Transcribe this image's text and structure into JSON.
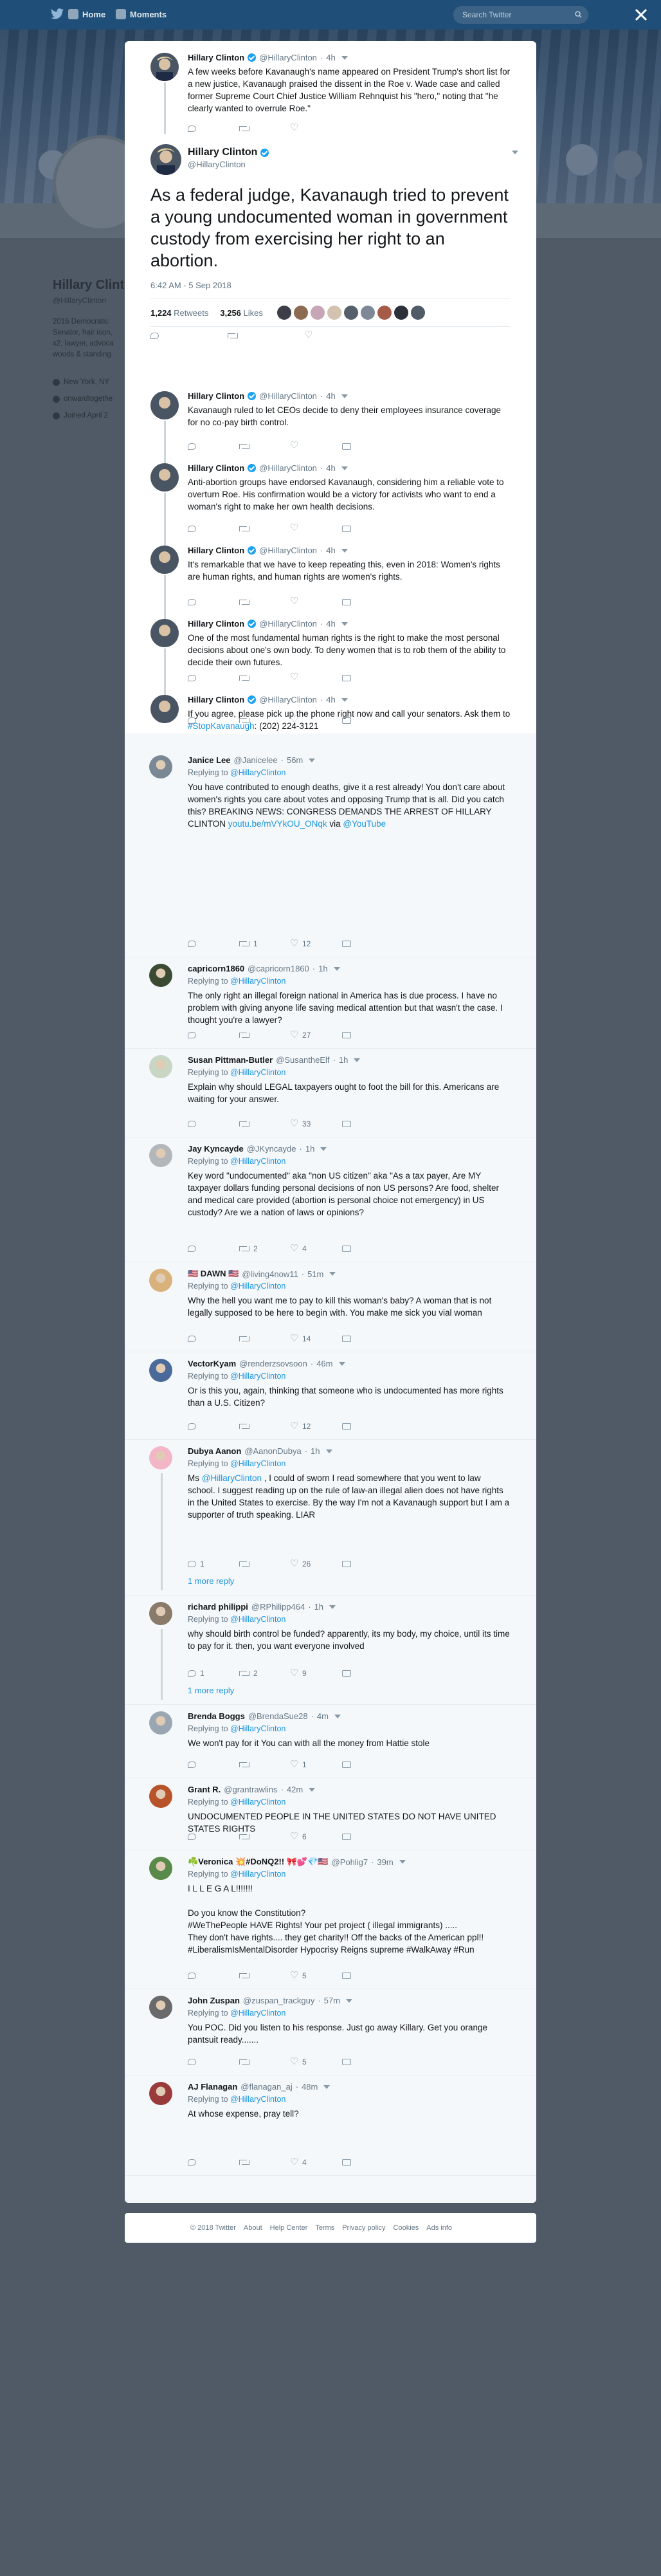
{
  "topnav": {
    "home": "Home",
    "moments": "Moments",
    "search_placeholder": "Search Twitter"
  },
  "profile": {
    "name": "Hillary Clinton",
    "handle": "@HillaryClinton",
    "bio_lines": [
      "2016 Democratic",
      "Senator, hair icon,",
      "x2, lawyer, advoca",
      "woods & standing"
    ],
    "location": "New York, NY",
    "website": "onwardtogethe",
    "joined": "Joined April 2"
  },
  "thread": [
    {
      "name": "Hillary Clinton",
      "handle": "@HillaryClinton",
      "time": "4h",
      "text": "A few weeks before Kavanaugh's name appeared on President Trump's short list for a new justice, Kavanaugh praised the dissent in the Roe v. Wade case and called former Supreme Court Chief Justice William Rehnquist his \"hero,\" noting that \"he clearly wanted to overrule Roe.\""
    }
  ],
  "main_tweet": {
    "name": "Hillary Clinton",
    "handle": "@HillaryClinton",
    "text": "As a federal judge, Kavanaugh tried to prevent a young undocumented woman in government custody from exercising her right to an abortion.",
    "timestamp": "6:42 AM - 5 Sep 2018",
    "retweets": "1,224",
    "retweets_label": "Retweets",
    "likes": "3,256",
    "likes_label": "Likes"
  },
  "followups": [
    {
      "name": "Hillary Clinton",
      "handle": "@HillaryClinton",
      "time": "4h",
      "text": "Kavanaugh ruled to let CEOs decide to deny their employees insurance coverage for no co-pay birth control."
    },
    {
      "name": "Hillary Clinton",
      "handle": "@HillaryClinton",
      "time": "4h",
      "text": "Anti-abortion groups have endorsed Kavanaugh, considering him a reliable vote to overturn Roe. His confirmation would be a victory for activists who want to end a woman's right to make her own health decisions."
    },
    {
      "name": "Hillary Clinton",
      "handle": "@HillaryClinton",
      "time": "4h",
      "text": "It's remarkable that we have to keep repeating this, even in 2018: Women's rights are human rights, and human rights are women's rights."
    },
    {
      "name": "Hillary Clinton",
      "handle": "@HillaryClinton",
      "time": "4h",
      "text": "One of the most fundamental human rights is the right to make the most personal decisions about one's own body. To deny women that is to rob them of the ability to decide their own futures."
    },
    {
      "name": "Hillary Clinton",
      "handle": "@HillaryClinton",
      "time": "4h",
      "text_pre": "If you agree, please pick up the phone right now and call your senators. Ask them to ",
      "hashtag": "#StopKavanaugh",
      "text_post": ": (202) 224-3121"
    }
  ],
  "replies": [
    {
      "name": "Janice Lee",
      "handle": "@Janicelee",
      "time": "56m",
      "replying": "Replying to",
      "mention": "@HillaryClinton",
      "text": "You have contributed to enough deaths, give it a rest already! You don't care about women's rights you care about votes and opposing Trump that is all. Did you catch this? BREAKING NEWS: CONGRESS DEMANDS THE ARREST OF HILLARY CLINTON ",
      "link": "youtu.be/mVYkOU_ONqk",
      "via": " via ",
      "via_link": "@YouTube",
      "reply_count": "",
      "rt_count": "1",
      "like_count": "12"
    },
    {
      "name": "capricorn1860",
      "handle": "@capricorn1860",
      "time": "1h",
      "replying": "Replying to",
      "mention": "@HillaryClinton",
      "text": "The only right an illegal foreign national in America has is due process. I have no problem with giving anyone life saving medical attention but that wasn't the case. I thought you're a lawyer?",
      "reply_count": "",
      "rt_count": "",
      "like_count": "27"
    },
    {
      "name": "Susan Pittman-Butler",
      "handle": "@SusantheElf",
      "time": "1h",
      "replying": "Replying to",
      "mention": "@HillaryClinton",
      "text": "Explain why should LEGAL taxpayers ought to foot the bill for this. Americans are waiting for your answer.",
      "reply_count": "",
      "rt_count": "",
      "like_count": "33"
    },
    {
      "name": "Jay Kyncayde",
      "handle": "@JKyncayde",
      "time": "1h",
      "replying": "Replying to",
      "mention": "@HillaryClinton",
      "text": "Key word \"undocumented\" aka \"non US citizen\" aka \"As a tax payer, Are MY taxpayer dollars funding personal decisions of non US persons? Are food, shelter and medical care provided (abortion is personal choice not emergency) in US custody? Are we a nation of laws or opinions?",
      "reply_count": "",
      "rt_count": "2",
      "like_count": "4"
    },
    {
      "name": "🇺🇸 DAWN 🇺🇸",
      "handle": "@living4now11",
      "time": "51m",
      "replying": "Replying to",
      "mention": "@HillaryClinton",
      "text": "Why the hell you want me to pay to kill this woman's baby? A woman that is not legally supposed to be here to begin with. You make me sick you vial woman",
      "reply_count": "",
      "rt_count": "",
      "like_count": "14"
    },
    {
      "name": "VectorKyam",
      "handle": "@renderzsovsoon",
      "time": "46m",
      "replying": "Replying to",
      "mention": "@HillaryClinton",
      "text": "Or is this you, again, thinking that someone who is undocumented has more rights than a U.S. Citizen?",
      "reply_count": "",
      "rt_count": "",
      "like_count": "12"
    },
    {
      "name": "Dubya Aanon",
      "handle": "@AanonDubya",
      "time": "1h",
      "replying": "Replying to",
      "mention": "@HillaryClinton",
      "text_pre": "Ms ",
      "text_mention": "@HillaryClinton",
      "text": " , I could of sworn I read somewhere that you went to law school. I suggest reading up on the rule of law-an illegal alien does not have rights in the United States to exercise. By the way I'm not a Kavanaugh support but I am a supporter of truth speaking. LIAR",
      "reply_count": "1",
      "rt_count": "",
      "like_count": "26",
      "more": "1 more reply"
    },
    {
      "name": "richard philippi",
      "handle": "@RPhilipp464",
      "time": "1h",
      "replying": "Replying to",
      "mention": "@HillaryClinton",
      "text": "why should birth control be funded? apparently, its my body, my choice, until its time to pay for it. then, you want everyone involved",
      "reply_count": "1",
      "rt_count": "2",
      "like_count": "9",
      "more": "1 more reply"
    },
    {
      "name": "Brenda Boggs",
      "handle": "@BrendaSue28",
      "time": "4m",
      "replying": "Replying to",
      "mention": "@HillaryClinton",
      "text": "We won't pay for it You can with all the money from Hattie stole",
      "reply_count": "",
      "rt_count": "",
      "like_count": "1"
    },
    {
      "name": "Grant R.",
      "handle": "@grantrawlins",
      "time": "42m",
      "replying": "Replying to",
      "mention": "@HillaryClinton",
      "text": "UNDOCUMENTED PEOPLE IN THE UNITED STATES DO NOT HAVE UNITED STATES RIGHTS",
      "reply_count": "",
      "rt_count": "",
      "like_count": "6"
    },
    {
      "name": "☘️Veronica 💥#DoNQ2!! 🎀💕💎🇺🇸",
      "handle": "@Pohlig7",
      "time": "39m",
      "replying": "Replying to",
      "mention": "@HillaryClinton",
      "text_lines": [
        "I L L E G A L!!!!!!!",
        "",
        "Do you know the Constitution?",
        "#WeThePeople HAVE Rights! Your pet project ( illegal immigrants) .....",
        "  They don't have rights.... they get charity!! Off the backs of the American ppl!!",
        "#LiberalismIsMentalDisorder Hypocrisy Reigns supreme #WalkAway #Run"
      ],
      "reply_count": "",
      "rt_count": "",
      "like_count": "5"
    },
    {
      "name": "John Zuspan",
      "handle": "@zuspan_trackguy",
      "time": "57m",
      "replying": "Replying to",
      "mention": "@HillaryClinton",
      "text": "You POC. Did you listen to his response. Just go away Killary. Get you orange pantsuit ready.......",
      "reply_count": "",
      "rt_count": "",
      "like_count": "5"
    },
    {
      "name": "AJ Flanagan",
      "handle": "@flanagan_aj",
      "time": "48m",
      "replying": "Replying to",
      "mention": "@HillaryClinton",
      "text": "At whose expense, pray tell?",
      "reply_count": "",
      "rt_count": "",
      "like_count": "4"
    }
  ],
  "footer": {
    "links": [
      "© 2018 Twitter",
      "About",
      "Help Center",
      "Terms",
      "Privacy policy",
      "Cookies",
      "Ads info"
    ]
  },
  "colors": {
    "accent": "#1da1f2",
    "link": "#1b95e0",
    "muted": "#657786",
    "nav": "#1f4f78"
  }
}
